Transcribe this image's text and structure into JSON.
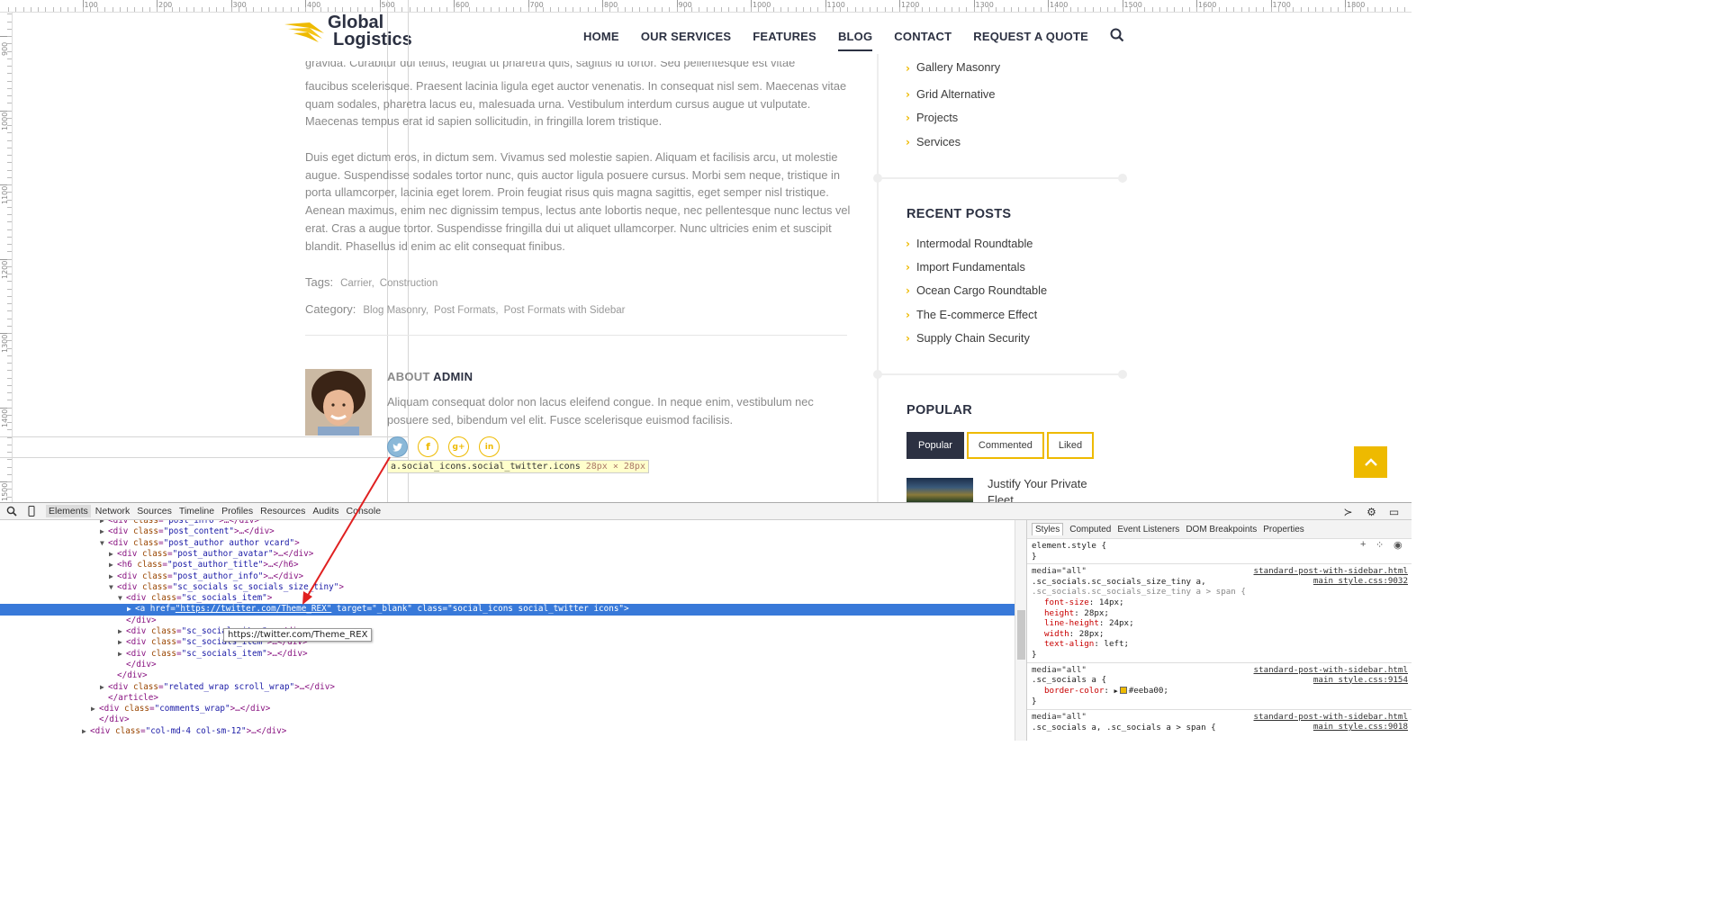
{
  "ruler": {
    "top_labels": [
      "100",
      "200",
      "300",
      "400",
      "500",
      "600",
      "700",
      "800",
      "900",
      "1000",
      "1100",
      "1200",
      "1300",
      "1400",
      "1500",
      "1600",
      "1700",
      "1800"
    ],
    "left_labels": [
      "900",
      "1000",
      "1100",
      "1200",
      "1300",
      "1400",
      "1500"
    ]
  },
  "site": {
    "logo_line1": "Global",
    "logo_line2": "Logistics",
    "nav": [
      "HOME",
      "OUR SERVICES",
      "FEATURES",
      "BLOG",
      "CONTACT",
      "REQUEST A QUOTE"
    ],
    "nav_active": "BLOG",
    "search_icon": "search-icon"
  },
  "post": {
    "para1_partial": "gravida. Curabitur dui tellus, feugiat ut pharetra quis, sagittis id tortor. Sed pellentesque est vitae",
    "para1": "faucibus scelerisque. Praesent lacinia ligula eget auctor venenatis. In consequat nisl sem. Maecenas vitae quam sodales, pharetra lacus eu, malesuada urna. Vestibulum interdum cursus augue ut vulputate. Maecenas tempus erat id sapien sollicitudin, in fringilla lorem tristique.",
    "para2": "Duis eget dictum eros, in dictum sem. Vivamus sed molestie sapien. Aliquam et facilisis arcu, ut molestie augue. Suspendisse sodales tortor nunc, quis auctor ligula posuere cursus. Morbi sem neque, tristique in porta ullamcorper, lacinia eget lorem. Proin feugiat risus quis magna sagittis, eget semper nisl tristique. Aenean maximus, enim nec dignissim tempus, lectus ante lobortis neque, nec pellentesque nunc lectus vel erat. Cras a augue tortor. Suspendisse fringilla dui ut aliquet ullamcorper. Nunc ultricies enim et suscipit blandit. Phasellus id enim ac elit consequat finibus.",
    "tags_label": "Tags:",
    "tags": [
      "Carrier,",
      "Construction"
    ],
    "category_label": "Category:",
    "categories": [
      "Blog Masonry,",
      "Post Formats,",
      "Post Formats with Sidebar"
    ],
    "about_pre": "ABOUT",
    "about_name": "ADMIN",
    "about_text": "Aliquam consequat dolor non lacus eleifend congue. In neque enim, vestibulum nec posuere sed, bibendum vel elit. Fusce scelerisque euismod facilisis.",
    "socials": [
      "twitter-icon",
      "facebook-icon",
      "google-plus-icon",
      "linkedin-icon"
    ],
    "social_glyphs": [
      "t",
      "f",
      "g+",
      "in"
    ],
    "inspect_tooltip": "a.social_icons.social_twitter.icons",
    "inspect_dims": "28px × 28px"
  },
  "sidebar": {
    "cat_links": [
      "Gallery Masonry",
      "Grid Alternative",
      "Projects",
      "Services"
    ],
    "recent_title": "RECENT POSTS",
    "recent_links": [
      "Intermodal Roundtable",
      "Import Fundamentals",
      "Ocean Cargo Roundtable",
      "The E-commerce Effect",
      "Supply Chain Security"
    ],
    "popular_title": "POPULAR",
    "popular_tabs": [
      "Popular",
      "Commented",
      "Liked"
    ],
    "popular_active": "Popular",
    "popular_post_title": "Justify Your Private Fleet"
  },
  "devtools": {
    "tabs": [
      "Elements",
      "Network",
      "Sources",
      "Timeline",
      "Profiles",
      "Resources",
      "Audits",
      "Console"
    ],
    "active_tab": "Elements",
    "style_tabs": [
      "Styles",
      "Computed",
      "Event Listeners",
      "DOM Breakpoints",
      "Properties"
    ],
    "active_style_tab": "Styles",
    "link_tooltip": "https://twitter.com/Theme_REX",
    "dom_lines": [
      {
        "indent": 12,
        "tri": "▶",
        "html": "<div class=\"post_info\">…</div>",
        "partial": true
      },
      {
        "indent": 12,
        "tri": "▶",
        "html": "<div class=\"post_content\">…</div>"
      },
      {
        "indent": 12,
        "tri": "▼",
        "html": "<div class=\"post_author author vcard\">"
      },
      {
        "indent": 13,
        "tri": "▶",
        "html": "<div class=\"post_author_avatar\">…</div>"
      },
      {
        "indent": 13,
        "tri": "▶",
        "html": "<h6 class=\"post_author_title\">…</h6>"
      },
      {
        "indent": 13,
        "tri": "▶",
        "html": "<div class=\"post_author_info\">…</div>"
      },
      {
        "indent": 13,
        "tri": "▼",
        "html": "<div class=\"sc_socials sc_socials_size_tiny\">"
      },
      {
        "indent": 14,
        "tri": "▼",
        "html": "<div class=\"sc_socials_item\">"
      },
      {
        "indent": 15,
        "tri": "▶",
        "html": "<a href=\"https://twitter.com/Theme_REX\" target=\"_blank\" class=\"social_icons social_twitter icons\">",
        "selected": true
      },
      {
        "indent": 14,
        "tri": "",
        "html": "</div>"
      },
      {
        "indent": 14,
        "tri": "▶",
        "html": "<div class=\"sc_socials_item\">…</div>"
      },
      {
        "indent": 14,
        "tri": "▶",
        "html": "<div class=\"sc_socials_item\">…</div>"
      },
      {
        "indent": 14,
        "tri": "▶",
        "html": "<div class=\"sc_socials_item\">…</div>"
      },
      {
        "indent": 14,
        "tri": "",
        "html": "</div>"
      },
      {
        "indent": 13,
        "tri": "",
        "html": "</div>"
      },
      {
        "indent": 12,
        "tri": "▶",
        "html": "<div class=\"related_wrap scroll_wrap\">…</div>"
      },
      {
        "indent": 12,
        "tri": "",
        "html": "</article>"
      },
      {
        "indent": 11,
        "tri": "▶",
        "html": "<div class=\"comments_wrap\">…</div>"
      },
      {
        "indent": 11,
        "tri": "",
        "html": "</div>"
      },
      {
        "indent": 10,
        "tri": "▶",
        "html": "<div class=\"col-md-4 col-sm-12\">…</div>"
      }
    ],
    "styles": {
      "element_style": "element.style {",
      "element_style_close": "}",
      "rule1_media": "media=\"all\"",
      "rule1_src1": "standard-post-with-sidebar.html",
      "rule1_src2": "main_style.css:9032",
      "rule1_sel1": ".sc_socials.sc_socials_size_tiny a,",
      "rule1_sel2": ".sc_socials.sc_socials_size_tiny a > span {",
      "rule1_props": [
        [
          "font-size",
          "14px;"
        ],
        [
          "height",
          "28px;"
        ],
        [
          "line-height",
          "24px;"
        ],
        [
          "width",
          "28px;"
        ],
        [
          "text-align",
          "left;"
        ]
      ],
      "rule2_media": "media=\"all\"",
      "rule2_src1": "standard-post-with-sidebar.html",
      "rule2_src2": "main_style.css:9154",
      "rule2_sel": ".sc_socials a {",
      "rule2_prop_name": "border-color",
      "rule2_prop_val": "#eeba00;",
      "rule3_media": "media=\"all\"",
      "rule3_src1": "standard-post-with-sidebar.html",
      "rule3_src2": "main_style.css:9018",
      "rule3_sel": ".sc_socials a, .sc_socials a > span {",
      "close": "}"
    }
  },
  "colors": {
    "accent": "#eeba00",
    "dark": "#2c3142",
    "selection": "#3879d9",
    "annotation_arrow": "#e02020"
  }
}
